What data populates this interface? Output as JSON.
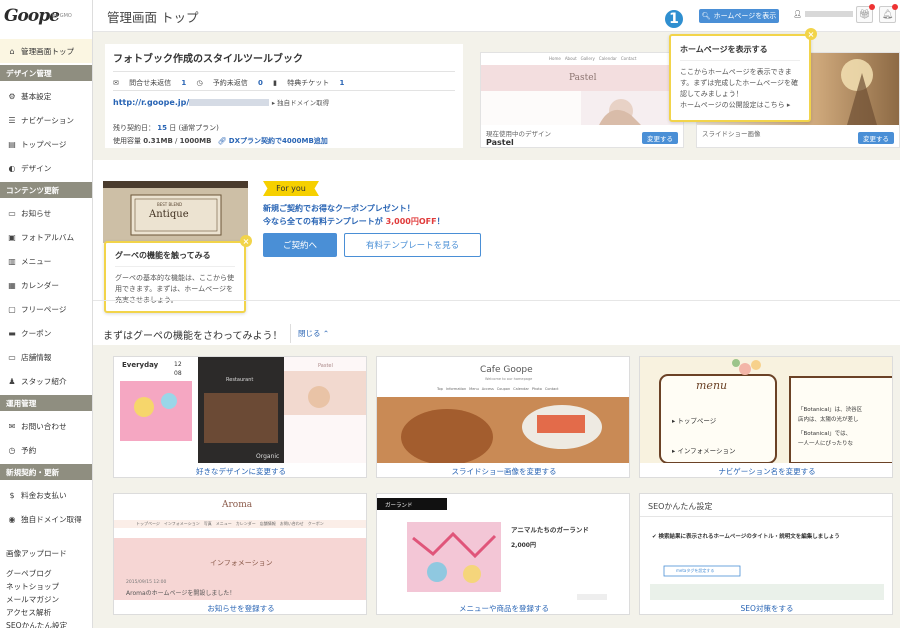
{
  "logo": {
    "text": "Goope",
    "by": "by GMO"
  },
  "sidebar": {
    "top": {
      "label": "管理画面トップ",
      "icon": "home-icon"
    },
    "sections": [
      {
        "title": "デザイン管理",
        "items": [
          {
            "label": "基本設定",
            "icon": "gear-icon"
          },
          {
            "label": "ナビゲーション",
            "icon": "list-icon"
          },
          {
            "label": "トップページ",
            "icon": "page-icon"
          },
          {
            "label": "デザイン",
            "icon": "palette-icon"
          }
        ]
      },
      {
        "title": "コンテンツ更新",
        "items": [
          {
            "label": "お知らせ",
            "icon": "news-icon"
          },
          {
            "label": "フォトアルバム",
            "icon": "photo-icon"
          },
          {
            "label": "メニュー",
            "icon": "menu-icon"
          },
          {
            "label": "カレンダー",
            "icon": "calendar-icon"
          },
          {
            "label": "フリーページ",
            "icon": "freepage-icon"
          },
          {
            "label": "クーポン",
            "icon": "coupon-icon"
          },
          {
            "label": "店舗情報",
            "icon": "shop-icon"
          },
          {
            "label": "スタッフ紹介",
            "icon": "staff-icon"
          }
        ]
      },
      {
        "title": "運用管理",
        "items": [
          {
            "label": "お問い合わせ",
            "icon": "mail-icon"
          },
          {
            "label": "予約",
            "icon": "reserve-icon"
          }
        ]
      },
      {
        "title": "新規契約・更新",
        "items": [
          {
            "label": "料金お支払い",
            "icon": "dollar-icon"
          },
          {
            "label": "独自ドメイン取得",
            "icon": "domain-icon"
          }
        ]
      }
    ],
    "plain_items": [
      "画像アップロード",
      "グーペブログ",
      "ネットショップ",
      "メールマガジン",
      "アクセス解析",
      "SEOかんたん設定"
    ]
  },
  "header": {
    "title": "管理画面 トップ",
    "homepage_button": "ホームページを表示",
    "user_icon": "user-icon",
    "gift_icon": "gift-icon",
    "bell_icon": "bell-icon"
  },
  "site": {
    "title": "フォトブック作成のスタイルツールブック",
    "unanswered_inquiries_label": "問合せ未返信",
    "unanswered_inquiries": "1",
    "unanswered_reservations_label": "予約未返信",
    "unanswered_reservations": "0",
    "tickets_label": "特典チケット",
    "tickets": "1",
    "url": "http://r.goope.jp/",
    "domain_link": "独自ドメイン取得",
    "remaining_label": "残り契約日：",
    "remaining_days": "15",
    "remaining_unit": "日",
    "plan": "(通常プラン)",
    "usage_label": "使用容量",
    "usage_used": "0.31MB",
    "usage_sep": "/",
    "usage_total": "1000MB",
    "upgrade_link": "DXプラン契約で4000MB追加"
  },
  "design_cards": [
    {
      "caption": "現在使用中のデザイン",
      "name": "Pastel",
      "button": "変更する",
      "thumb_label": "Pastel",
      "nav": [
        "Home",
        "About",
        "Gallery",
        "Calendar",
        "Contact"
      ]
    },
    {
      "caption": "スライドショー画像",
      "name": "",
      "button": "変更する"
    }
  ],
  "tooltip_homepage": {
    "badge": "1",
    "title": "ホームページを表示する",
    "body": "ここからホームページを表示できます。まずは完成したホームページを確認してみましょう！",
    "link": "ホームページの公開設定はこちら",
    "close": "×"
  },
  "tooltip_features": {
    "title": "グーペの機能を触ってみる",
    "body": "グーペの基本的な機能は、ここから使用できます。まずは、ホームページを充実させましょう。",
    "close": "×"
  },
  "promo": {
    "badge": "For you",
    "line1": "新規ご契約でお得なクーポンプレゼント！",
    "line2_pre": "今なら全ての有料テンプレートが",
    "line2_price": "3,000円OFF",
    "line2_post": "！",
    "button_primary": "ご契約へ",
    "button_secondary": "有料テンプレートを見る",
    "image_label": "Antique",
    "image_small": "BEST BLEND"
  },
  "features": {
    "heading": "まずはグーペの機能をさわってみよう！",
    "close": "閉じる",
    "cards": [
      {
        "label": "好きなデザインに変更する",
        "thumb_words": [
          "Everyday",
          "12",
          "08",
          "Restaurant",
          "Organic",
          "Pastel"
        ]
      },
      {
        "label": "スライドショー画像を変更する",
        "thumb_words": [
          "Cafe Goope",
          "Welcome to our homepage",
          "Top",
          "Information",
          "Menu",
          "Access",
          "Coupon",
          "Calendar",
          "Photo",
          "Contact"
        ]
      },
      {
        "label": "ナビゲーション名を変更する",
        "thumb_words": [
          "menu",
          "トップページ",
          "インフォメーション",
          "「Botanical」は、渋谷区",
          "店内は、太陽の光が差し",
          "「Botanical」では、",
          "一人一人にぴったりな"
        ]
      },
      {
        "label": "お知らせを登録する",
        "thumb_words": [
          "Aroma",
          "トップページ",
          "インフォメーション",
          "写真",
          "メニュー",
          "カレンダー",
          "店舗情報",
          "お問い合わせ",
          "クーポン",
          "インフォメーション",
          "2015/09/15 12:00",
          "Aromaのホームページを開設しました！"
        ]
      },
      {
        "label": "メニューや商品を登録する",
        "thumb_words": [
          "ガーランド",
          "アニマルたちのガーランド",
          "2,000円"
        ]
      },
      {
        "label": "SEO対策をする",
        "thumb_words": [
          "SEOかんたん設定",
          "検索結果に表示されるホームページのタイトル・説明文を編集しましょう",
          "metaタグを設定する"
        ]
      }
    ]
  }
}
